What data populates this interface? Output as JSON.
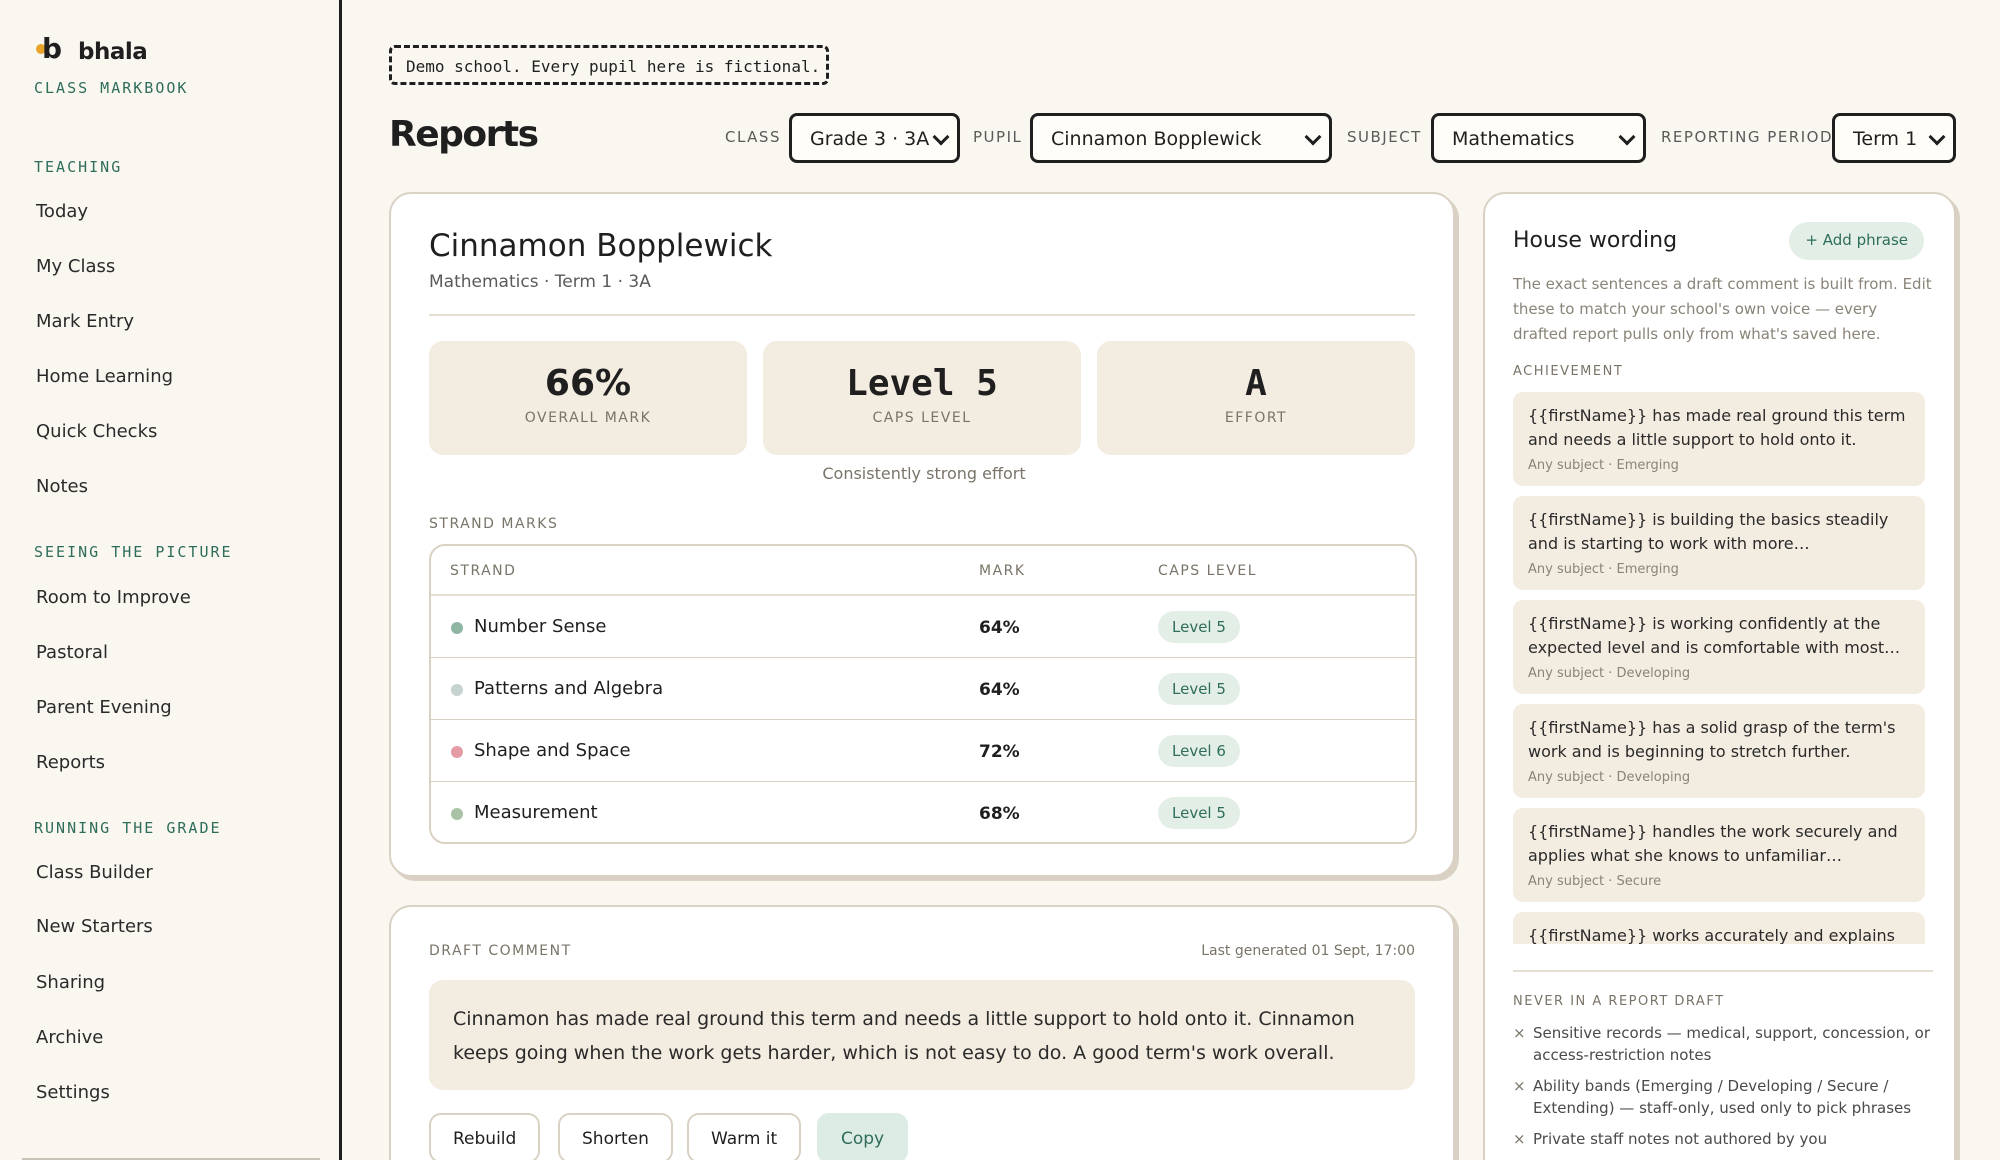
{
  "brand": {
    "name": "bhala",
    "subtitle": "CLASS MARKBOOK"
  },
  "sidebar": {
    "sections": [
      {
        "label": "TEACHING",
        "items": [
          "Today",
          "My Class",
          "Mark Entry",
          "Home Learning",
          "Quick Checks",
          "Notes"
        ]
      },
      {
        "label": "SEEING THE PICTURE",
        "items": [
          "Room to Improve",
          "Pastoral",
          "Parent Evening",
          "Reports"
        ]
      },
      {
        "label": "RUNNING THE GRADE",
        "items": [
          "Class Builder",
          "New Starters",
          "Sharing",
          "Archive",
          "Settings"
        ]
      }
    ]
  },
  "banner": "Demo school. Every pupil here is fictional.",
  "page": {
    "title": "Reports"
  },
  "filters": {
    "class_label": "CLASS",
    "class_value": "Grade 3 · 3A",
    "pupil_label": "PUPIL",
    "pupil_value": "Cinnamon Bopplewick",
    "subject_label": "SUBJECT",
    "subject_value": "Mathematics",
    "period_label": "REPORTING PERIOD",
    "period_value": "Term 1"
  },
  "pupil": {
    "name": "Cinnamon Bopplewick",
    "meta": "Mathematics · Term 1 · 3A",
    "stats": [
      {
        "value": "66%",
        "label": "OVERALL MARK"
      },
      {
        "value": "Level 5",
        "label": "CAPS LEVEL"
      },
      {
        "value": "A",
        "label": "EFFORT"
      }
    ],
    "effort_note": "Consistently strong effort",
    "strand_title": "STRAND MARKS",
    "strand_headers": {
      "strand": "STRAND",
      "mark": "MARK",
      "caps": "CAPS LEVEL"
    },
    "strands": [
      {
        "name": "Number Sense",
        "mark": "64%",
        "level": "Level 5",
        "color": "#8fb5a3"
      },
      {
        "name": "Patterns and Algebra",
        "mark": "64%",
        "level": "Level 5",
        "color": "#c6d3d0"
      },
      {
        "name": "Shape and Space",
        "mark": "72%",
        "level": "Level 6",
        "color": "#e59ba3"
      },
      {
        "name": "Measurement",
        "mark": "68%",
        "level": "Level 5",
        "color": "#a9c2a5"
      }
    ]
  },
  "draft": {
    "title": "DRAFT COMMENT",
    "generated": "Last generated 01 Sept, 17:00",
    "text": "Cinnamon has made real ground this term and needs a little support to hold onto it. Cinnamon keeps going when the work gets harder, which is not easy to do. A good term's work overall.",
    "buttons": [
      "Rebuild",
      "Shorten",
      "Warm it",
      "Copy"
    ]
  },
  "wording": {
    "title": "House wording",
    "add_label": "+ Add phrase",
    "description": "The exact sentences a draft comment is built from. Edit these to match your school's own voice — every drafted report pulls only from what's saved here.",
    "section_label": "ACHIEVEMENT",
    "phrases": [
      {
        "text": "{{firstName}} has made real ground this term and needs a little support to hold onto it.",
        "tag": "Any subject · Emerging"
      },
      {
        "text": "{{firstName}} is building the basics steadily and is starting to work with more…",
        "tag": "Any subject · Emerging"
      },
      {
        "text": "{{firstName}} is working confidently at the expected level and is comfortable with most…",
        "tag": "Any subject · Developing"
      },
      {
        "text": "{{firstName}} has a solid grasp of the term's work and is beginning to stretch further.",
        "tag": "Any subject · Developing"
      },
      {
        "text": "{{firstName}} handles the work securely and applies what she knows to unfamiliar…",
        "tag": "Any subject · Secure"
      },
      {
        "text": "{{firstName}} works accurately and explains",
        "tag": ""
      }
    ],
    "never_label": "NEVER IN A REPORT DRAFT",
    "never_items": [
      "Sensitive records — medical, support, concession, or access-restriction notes",
      "Ability bands (Emerging / Developing / Secure / Extending) — staff-only, used only to pick phrases",
      "Private staff notes not authored by you"
    ]
  }
}
